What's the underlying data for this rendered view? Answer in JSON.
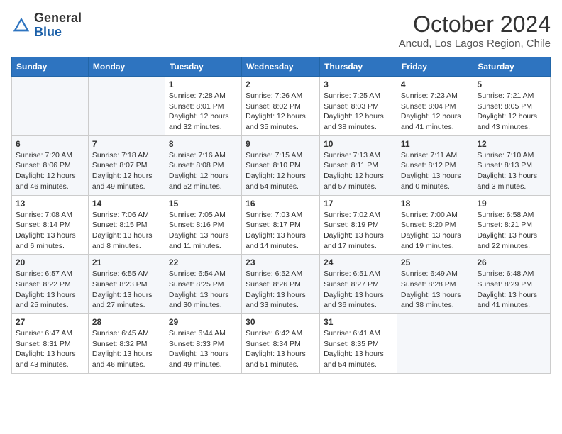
{
  "header": {
    "logo_general": "General",
    "logo_blue": "Blue",
    "month_year": "October 2024",
    "location": "Ancud, Los Lagos Region, Chile"
  },
  "days_of_week": [
    "Sunday",
    "Monday",
    "Tuesday",
    "Wednesday",
    "Thursday",
    "Friday",
    "Saturday"
  ],
  "weeks": [
    [
      {
        "day": "",
        "content": ""
      },
      {
        "day": "",
        "content": ""
      },
      {
        "day": "1",
        "content": "Sunrise: 7:28 AM\nSunset: 8:01 PM\nDaylight: 12 hours and 32 minutes."
      },
      {
        "day": "2",
        "content": "Sunrise: 7:26 AM\nSunset: 8:02 PM\nDaylight: 12 hours and 35 minutes."
      },
      {
        "day": "3",
        "content": "Sunrise: 7:25 AM\nSunset: 8:03 PM\nDaylight: 12 hours and 38 minutes."
      },
      {
        "day": "4",
        "content": "Sunrise: 7:23 AM\nSunset: 8:04 PM\nDaylight: 12 hours and 41 minutes."
      },
      {
        "day": "5",
        "content": "Sunrise: 7:21 AM\nSunset: 8:05 PM\nDaylight: 12 hours and 43 minutes."
      }
    ],
    [
      {
        "day": "6",
        "content": "Sunrise: 7:20 AM\nSunset: 8:06 PM\nDaylight: 12 hours and 46 minutes."
      },
      {
        "day": "7",
        "content": "Sunrise: 7:18 AM\nSunset: 8:07 PM\nDaylight: 12 hours and 49 minutes."
      },
      {
        "day": "8",
        "content": "Sunrise: 7:16 AM\nSunset: 8:08 PM\nDaylight: 12 hours and 52 minutes."
      },
      {
        "day": "9",
        "content": "Sunrise: 7:15 AM\nSunset: 8:10 PM\nDaylight: 12 hours and 54 minutes."
      },
      {
        "day": "10",
        "content": "Sunrise: 7:13 AM\nSunset: 8:11 PM\nDaylight: 12 hours and 57 minutes."
      },
      {
        "day": "11",
        "content": "Sunrise: 7:11 AM\nSunset: 8:12 PM\nDaylight: 13 hours and 0 minutes."
      },
      {
        "day": "12",
        "content": "Sunrise: 7:10 AM\nSunset: 8:13 PM\nDaylight: 13 hours and 3 minutes."
      }
    ],
    [
      {
        "day": "13",
        "content": "Sunrise: 7:08 AM\nSunset: 8:14 PM\nDaylight: 13 hours and 6 minutes."
      },
      {
        "day": "14",
        "content": "Sunrise: 7:06 AM\nSunset: 8:15 PM\nDaylight: 13 hours and 8 minutes."
      },
      {
        "day": "15",
        "content": "Sunrise: 7:05 AM\nSunset: 8:16 PM\nDaylight: 13 hours and 11 minutes."
      },
      {
        "day": "16",
        "content": "Sunrise: 7:03 AM\nSunset: 8:17 PM\nDaylight: 13 hours and 14 minutes."
      },
      {
        "day": "17",
        "content": "Sunrise: 7:02 AM\nSunset: 8:19 PM\nDaylight: 13 hours and 17 minutes."
      },
      {
        "day": "18",
        "content": "Sunrise: 7:00 AM\nSunset: 8:20 PM\nDaylight: 13 hours and 19 minutes."
      },
      {
        "day": "19",
        "content": "Sunrise: 6:58 AM\nSunset: 8:21 PM\nDaylight: 13 hours and 22 minutes."
      }
    ],
    [
      {
        "day": "20",
        "content": "Sunrise: 6:57 AM\nSunset: 8:22 PM\nDaylight: 13 hours and 25 minutes."
      },
      {
        "day": "21",
        "content": "Sunrise: 6:55 AM\nSunset: 8:23 PM\nDaylight: 13 hours and 27 minutes."
      },
      {
        "day": "22",
        "content": "Sunrise: 6:54 AM\nSunset: 8:25 PM\nDaylight: 13 hours and 30 minutes."
      },
      {
        "day": "23",
        "content": "Sunrise: 6:52 AM\nSunset: 8:26 PM\nDaylight: 13 hours and 33 minutes."
      },
      {
        "day": "24",
        "content": "Sunrise: 6:51 AM\nSunset: 8:27 PM\nDaylight: 13 hours and 36 minutes."
      },
      {
        "day": "25",
        "content": "Sunrise: 6:49 AM\nSunset: 8:28 PM\nDaylight: 13 hours and 38 minutes."
      },
      {
        "day": "26",
        "content": "Sunrise: 6:48 AM\nSunset: 8:29 PM\nDaylight: 13 hours and 41 minutes."
      }
    ],
    [
      {
        "day": "27",
        "content": "Sunrise: 6:47 AM\nSunset: 8:31 PM\nDaylight: 13 hours and 43 minutes."
      },
      {
        "day": "28",
        "content": "Sunrise: 6:45 AM\nSunset: 8:32 PM\nDaylight: 13 hours and 46 minutes."
      },
      {
        "day": "29",
        "content": "Sunrise: 6:44 AM\nSunset: 8:33 PM\nDaylight: 13 hours and 49 minutes."
      },
      {
        "day": "30",
        "content": "Sunrise: 6:42 AM\nSunset: 8:34 PM\nDaylight: 13 hours and 51 minutes."
      },
      {
        "day": "31",
        "content": "Sunrise: 6:41 AM\nSunset: 8:35 PM\nDaylight: 13 hours and 54 minutes."
      },
      {
        "day": "",
        "content": ""
      },
      {
        "day": "",
        "content": ""
      }
    ]
  ]
}
